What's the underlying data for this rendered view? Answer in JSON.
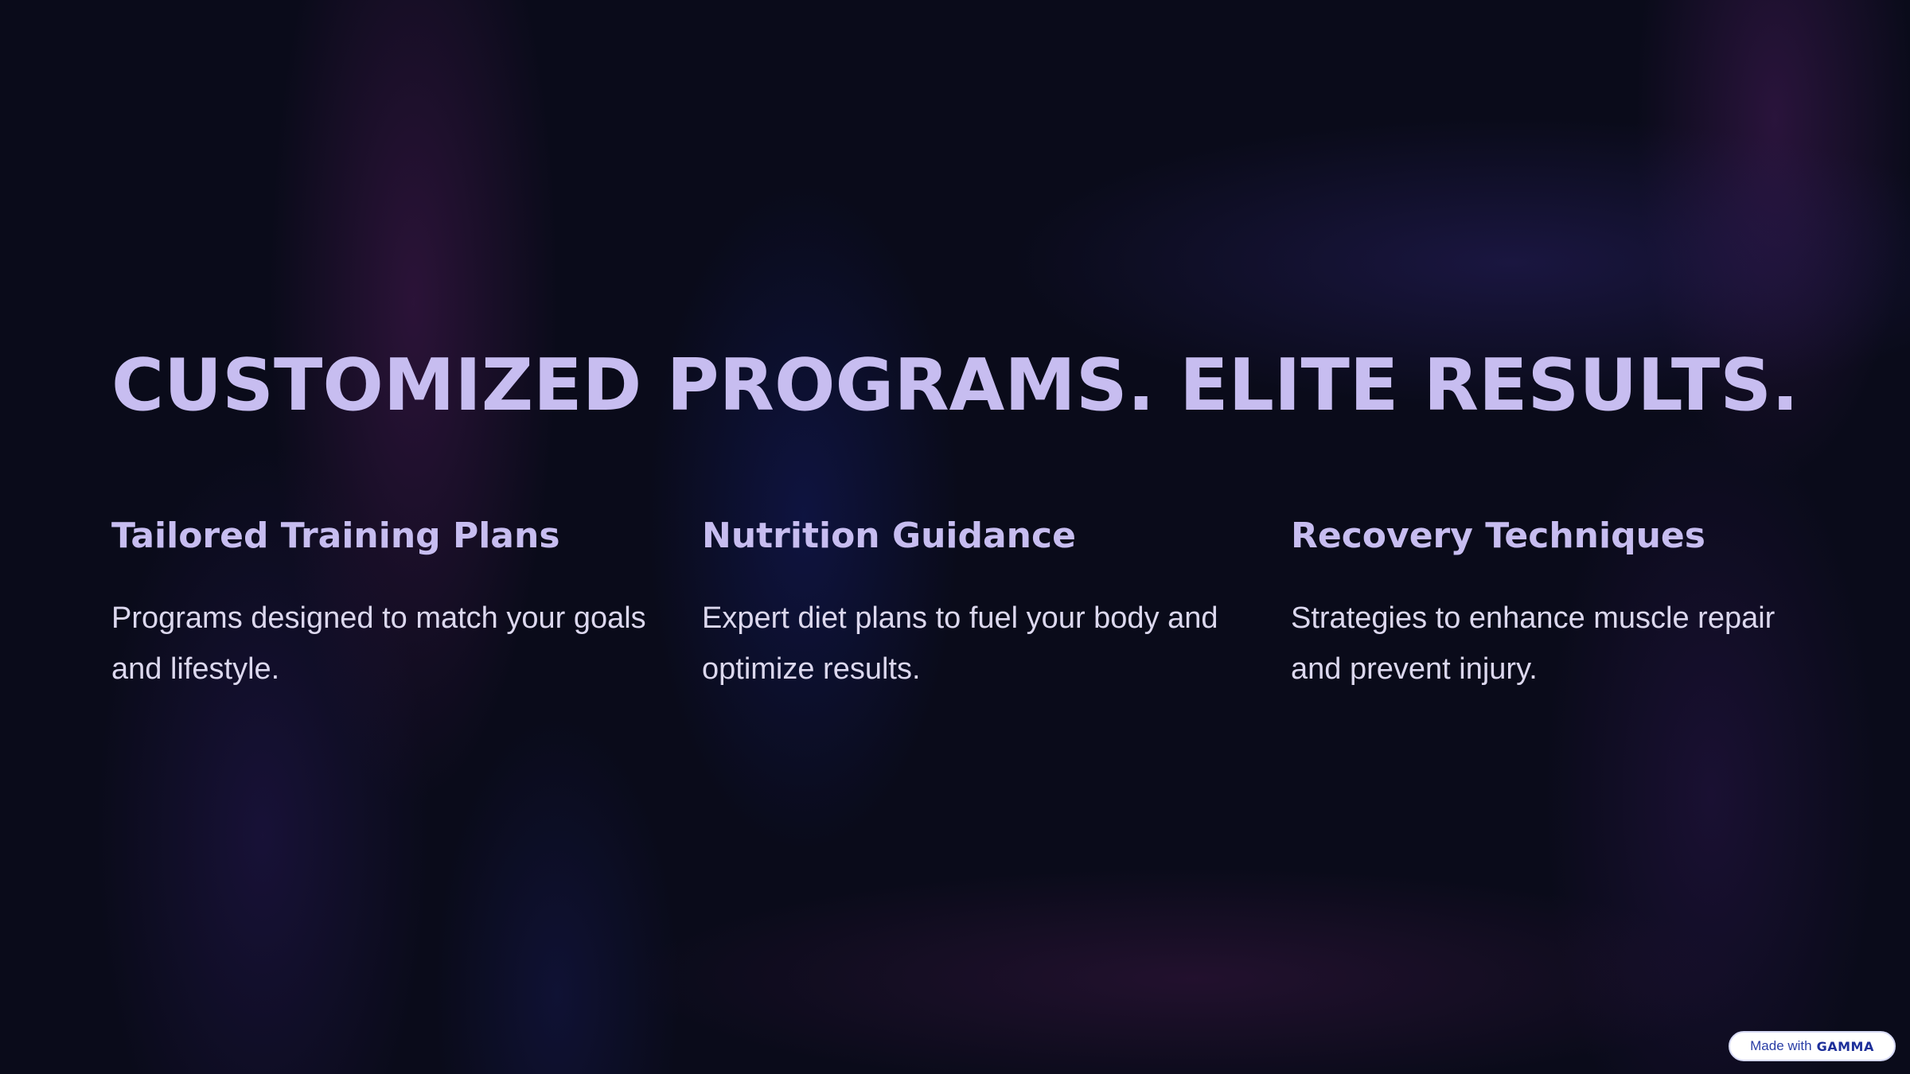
{
  "slide": {
    "title": "CUSTOMIZED PROGRAMS. ELITE RESULTS.",
    "columns": [
      {
        "heading": "Tailored Training Plans",
        "body": "Programs designed to match your goals and lifestyle."
      },
      {
        "heading": "Nutrition Guidance",
        "body": "Expert diet plans to fuel your body and optimize results."
      },
      {
        "heading": "Recovery Techniques",
        "body": "Strategies to enhance muscle repair and prevent injury."
      }
    ]
  },
  "badge": {
    "prefix": "Made with",
    "brand": "GAMMA"
  },
  "colors": {
    "background": "#0a0b1a",
    "heading": "#c7bdf0",
    "body_text": "#dcd8ee",
    "badge_text": "#2a3ea6"
  }
}
